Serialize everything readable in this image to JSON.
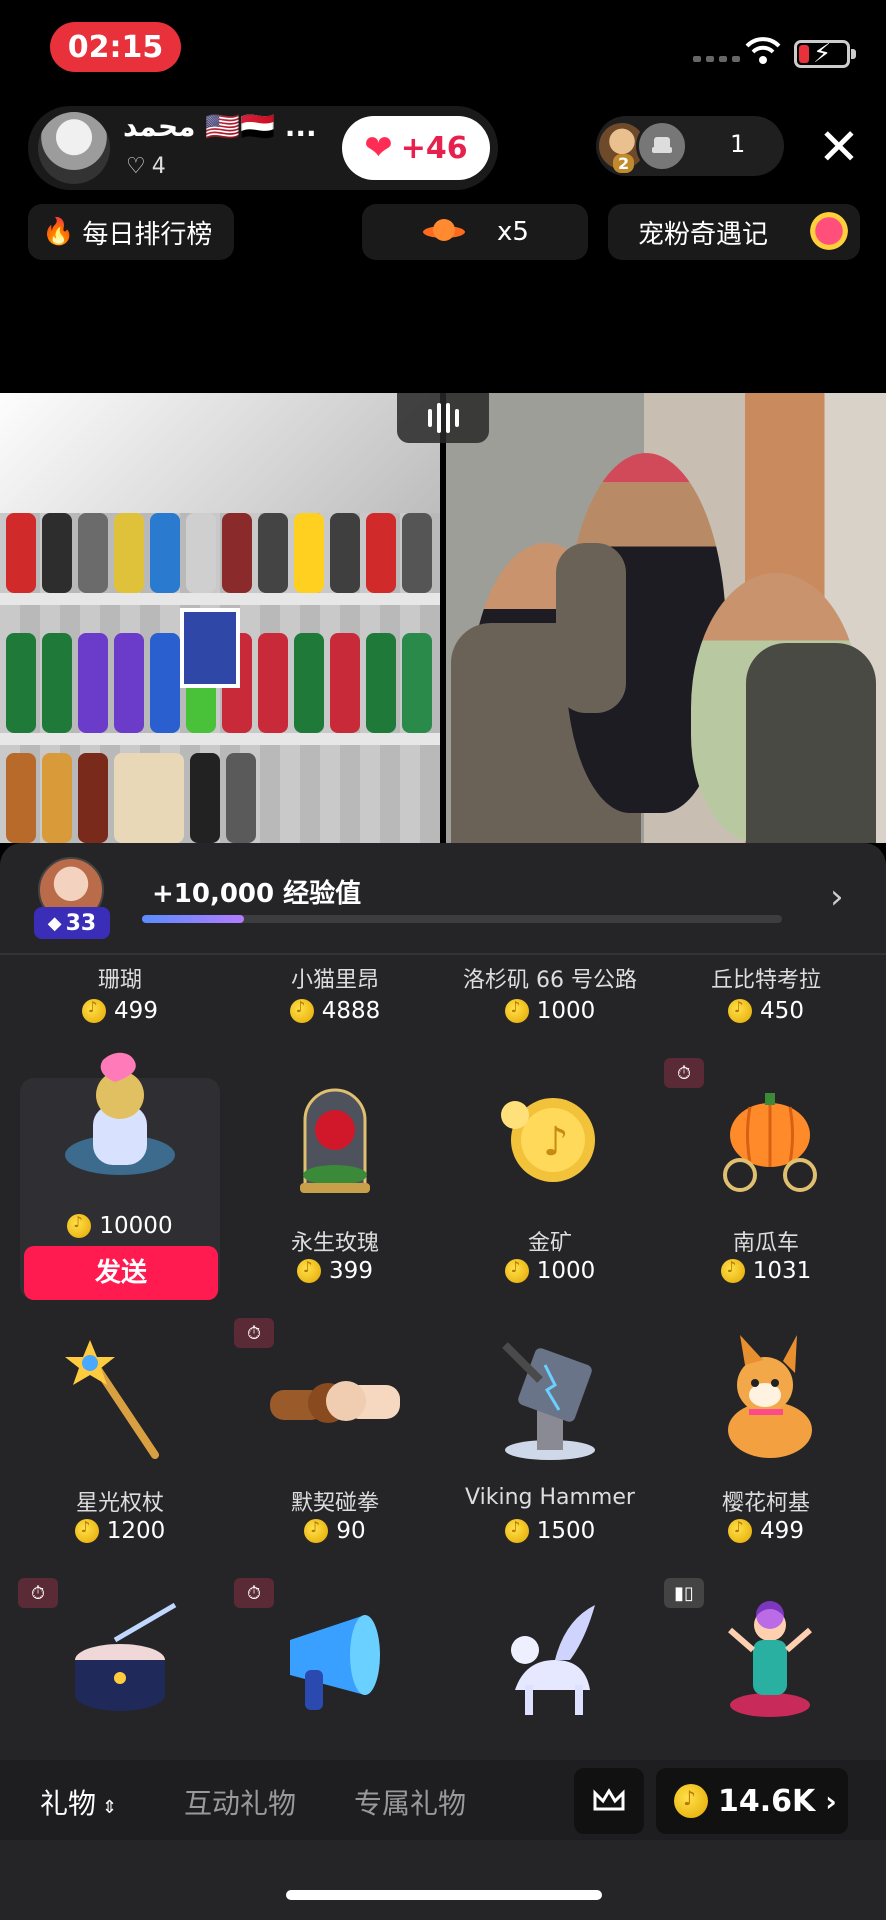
{
  "status_bar": {
    "time": "02:15"
  },
  "host": {
    "name": "محمد 🇺🇸🇾🇪 ...",
    "likes": "4",
    "like_button": "+46"
  },
  "viewers": {
    "top_rank": "2",
    "count": "1"
  },
  "chips": {
    "daily_rank": "每日排行榜",
    "multiplier": "x5",
    "fan_event": "宠粉奇遇记"
  },
  "level": {
    "badge": "33",
    "xp_text": "+10,000 经验值",
    "progress": 0.16
  },
  "gifts_row0": [
    {
      "name": "珊瑚",
      "price": "499"
    },
    {
      "name": "小猫里昂",
      "price": "4888"
    },
    {
      "name": "洛杉矶 66 号公路",
      "price": "1000"
    },
    {
      "name": "丘比特考拉",
      "price": "450"
    }
  ],
  "gifts_row1": [
    {
      "name": "",
      "price": "10000",
      "icon": "astronaut-gift-icon"
    },
    {
      "name": "永生玫瑰",
      "price": "399",
      "icon": "eternal-rose-icon"
    },
    {
      "name": "金矿",
      "price": "1000",
      "icon": "gold-coin-icon"
    },
    {
      "name": "南瓜车",
      "price": "1031",
      "icon": "pumpkin-carriage-icon"
    }
  ],
  "gifts_row2": [
    {
      "name": "星光权杖",
      "price": "1200",
      "icon": "star-scepter-icon"
    },
    {
      "name": "默契碰拳",
      "price": "90",
      "icon": "fist-bump-icon"
    },
    {
      "name": "Viking Hammer",
      "price": "1500",
      "icon": "viking-hammer-icon"
    },
    {
      "name": "樱花柯基",
      "price": "499",
      "icon": "corgi-icon"
    }
  ],
  "gifts_row3_icons": [
    "drum-icon",
    "megaphone-icon",
    "pegasus-icon",
    "clown-icon"
  ],
  "send_label": "发送",
  "tabs": {
    "gifts": "礼物",
    "interactive": "互动礼物",
    "exclusive": "专属礼物"
  },
  "balance": "14.6K",
  "colors": {
    "accent": "#ff1a50",
    "coin": "#ffcc1a",
    "panel": "#252527"
  }
}
